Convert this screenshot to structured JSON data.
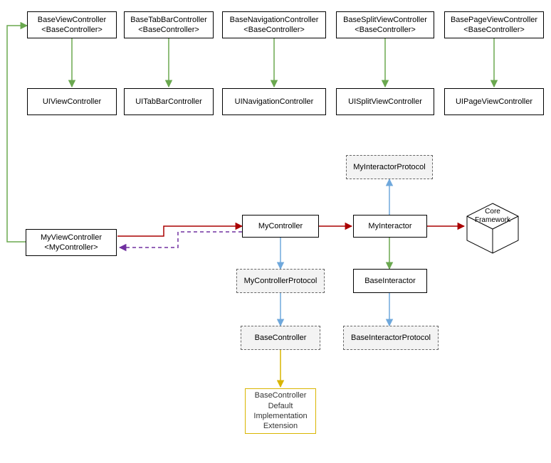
{
  "nodes": {
    "baseViewController": {
      "line1": "BaseViewController",
      "line2": "<BaseController>"
    },
    "baseTabBarController": {
      "line1": "BaseTabBarController",
      "line2": "<BaseController>"
    },
    "baseNavigationController": {
      "line1": "BaseNavigationController",
      "line2": "<BaseController>"
    },
    "baseSplitViewController": {
      "line1": "BaseSplitViewController",
      "line2": "<BaseController>"
    },
    "basePageViewController": {
      "line1": "BasePageViewController",
      "line2": "<BaseController>"
    },
    "uiViewController": "UIViewController",
    "uiTabBarController": "UITabBarController",
    "uiNavigationController": "UINavigationController",
    "uiSplitViewController": "UISplitViewController",
    "uiPageViewController": "UIPageViewController",
    "myInteractorProtocol": "MyInteractorProtocol",
    "myController": "MyController",
    "myInteractor": "MyInteractor",
    "coreFramework": {
      "line1": "Core",
      "line2": "Framework"
    },
    "myViewController": {
      "line1": "MyViewController",
      "line2": "<MyController>"
    },
    "myControllerProtocol": "MyControllerProtocol",
    "baseInteractor": "BaseInteractor",
    "baseController": "BaseController",
    "baseInteractorProtocol": "BaseInteractorProtocol",
    "baseControllerDefault": {
      "line1": "BaseController",
      "line2": "Default",
      "line3": "Implementation",
      "line4": "Extension"
    }
  },
  "colors": {
    "green": "#6aa84f",
    "blue": "#6fa8dc",
    "red": "#a00",
    "purple": "#7030a0",
    "yellow": "#d9b500"
  }
}
